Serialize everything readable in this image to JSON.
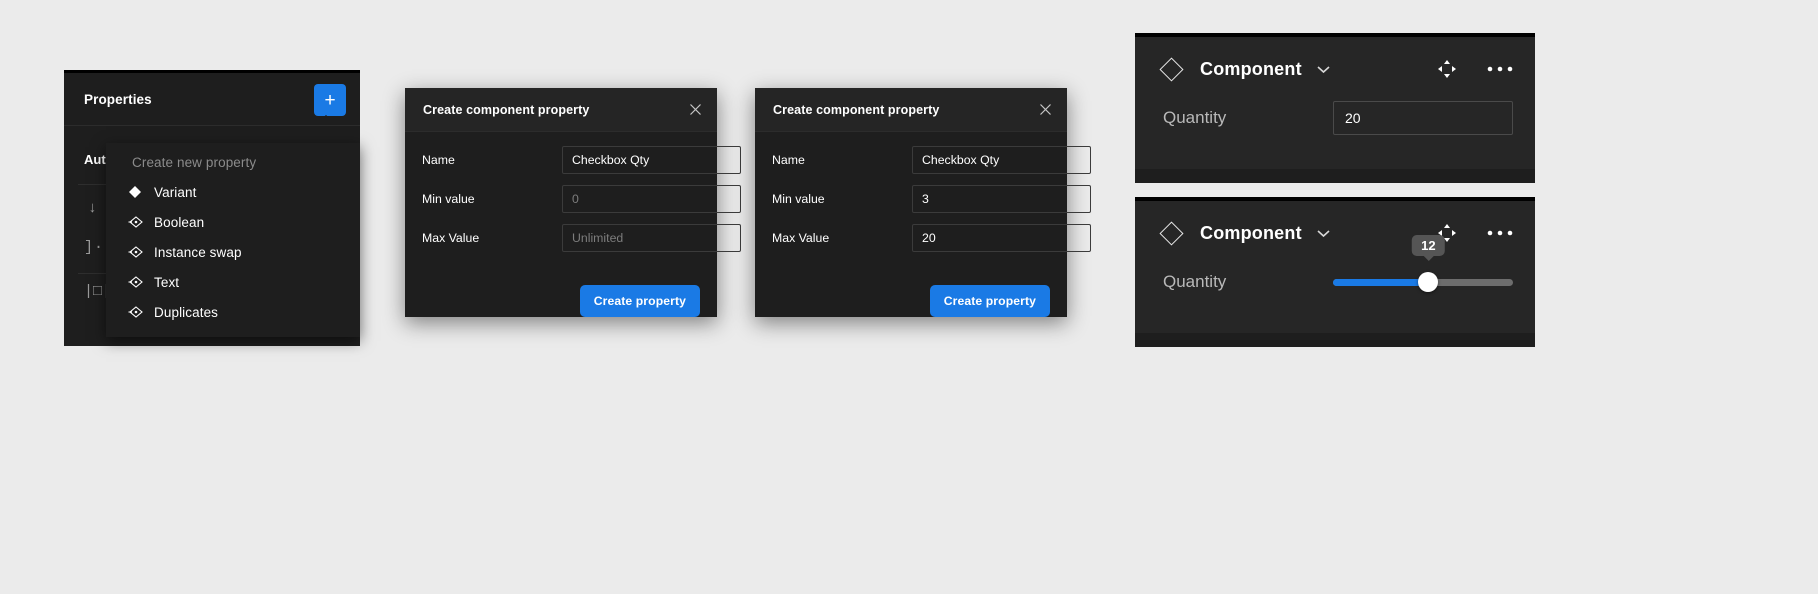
{
  "canvas": {
    "background_color": "#ebebeb"
  },
  "properties_panel": {
    "title": "Properties",
    "add_button_glyph": "+",
    "background_rows": {
      "auto_layout_label": "Aut",
      "arrow_glyph": "↓",
      "bracket_glyph": "]·[",
      "box_glyph": "|□|"
    },
    "menu": {
      "heading": "Create new property",
      "items": [
        {
          "label": "Variant",
          "icon": "diamond-filled-icon"
        },
        {
          "label": "Boolean",
          "icon": "boolean-property-icon"
        },
        {
          "label": "Instance swap",
          "icon": "instance-swap-property-icon"
        },
        {
          "label": "Text",
          "icon": "text-property-icon"
        },
        {
          "label": "Duplicates",
          "icon": "duplicates-property-icon"
        }
      ]
    }
  },
  "dialog_a": {
    "title": "Create component property",
    "close_icon": "close-icon",
    "fields": [
      {
        "label": "Name",
        "value": "Checkbox Qty",
        "placeholder": ""
      },
      {
        "label": "Min value",
        "value": "",
        "placeholder": "0"
      },
      {
        "label": "Max Value",
        "value": "",
        "placeholder": "Unlimited"
      }
    ],
    "submit_label": "Create property"
  },
  "dialog_b": {
    "title": "Create component property",
    "close_icon": "close-icon",
    "fields": [
      {
        "label": "Name",
        "value": "Checkbox Qty",
        "placeholder": ""
      },
      {
        "label": "Min value",
        "value": "3",
        "placeholder": ""
      },
      {
        "label": "Max Value",
        "value": "20",
        "placeholder": ""
      }
    ],
    "submit_label": "Create property"
  },
  "component_card_input": {
    "name": "Component",
    "diamond_icon": "component-diamond-icon",
    "chevron_icon": "chevron-down-icon",
    "move_icon": "move-icon",
    "more_icon": "more-horizontal-icon",
    "more_glyph": "···",
    "field_label": "Quantity",
    "field_value": "20"
  },
  "component_card_slider": {
    "name": "Component",
    "diamond_icon": "component-diamond-icon",
    "chevron_icon": "chevron-down-icon",
    "move_icon": "move-icon",
    "more_icon": "more-horizontal-icon",
    "more_glyph": "···",
    "field_label": "Quantity",
    "slider": {
      "value": "12",
      "min": 0,
      "max": 22,
      "fill_percent": 53
    }
  },
  "colors": {
    "accent_blue": "#1a7ae5",
    "panel_dark": "#1e1e1e",
    "card_dark": "#262626",
    "canvas_gray": "#ebebeb",
    "tooltip_gray": "#555555"
  }
}
